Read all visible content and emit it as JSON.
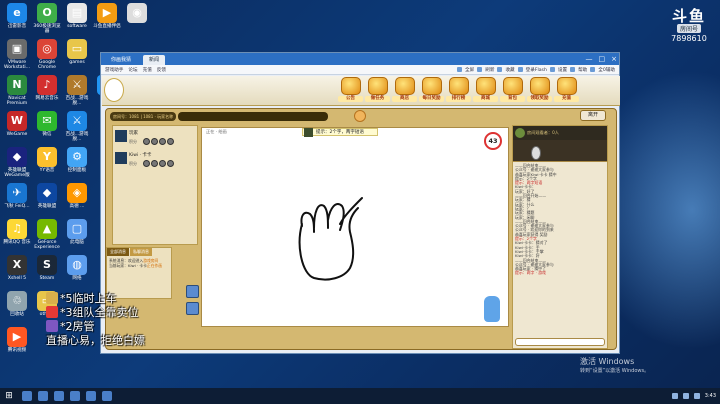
{
  "desktop": {
    "icons": [
      {
        "label": "迅雷影音",
        "color": "#1d87e8",
        "glyph": "e"
      },
      {
        "label": "360极速浏览器",
        "color": "#3fae49",
        "glyph": "O"
      },
      {
        "label": "software",
        "color": "#e8e8e8",
        "glyph": "▤"
      },
      {
        "label": "斗鱼直播伴侣",
        "color": "#f39c12",
        "glyph": "▶"
      },
      {
        "label": "",
        "color": "#dddddd",
        "glyph": "◉"
      },
      {
        "label": "VMware Workstati...",
        "color": "#6b6b6b",
        "glyph": "▣"
      },
      {
        "label": "Google Chrome",
        "color": "#db4437",
        "glyph": "◎"
      },
      {
        "label": "games",
        "color": "#e8c64a",
        "glyph": "▭"
      },
      {
        "label": "Navicat Premium",
        "color": "#2b8a3e",
        "glyph": "N"
      },
      {
        "label": "网易云音乐",
        "color": "#d32f2f",
        "glyph": "♪"
      },
      {
        "label": "百战...游戏脱...",
        "color": "#b07a2c",
        "glyph": "⚔"
      },
      {
        "label": "QQ",
        "color": "#2196f3",
        "glyph": "Q"
      },
      {
        "label": "WeGame",
        "color": "#c62828",
        "glyph": "W"
      },
      {
        "label": "微信",
        "color": "#2eb82e",
        "glyph": "✉"
      },
      {
        "label": "百战...游戏脱...",
        "color": "#1e88e5",
        "glyph": "⚔"
      },
      {
        "label": "英雄联盟 WeGame版",
        "color": "#1a237e",
        "glyph": "◆"
      },
      {
        "label": "YY语音",
        "color": "#fbc02d",
        "glyph": "Y"
      },
      {
        "label": "控制面板",
        "color": "#42a5f5",
        "glyph": "⚙"
      },
      {
        "label": "飞秋 FeiQ...",
        "color": "#1976d2",
        "glyph": "✈"
      },
      {
        "label": "英雄联盟",
        "color": "#0d47a1",
        "glyph": "◆"
      },
      {
        "label": "高德 ...",
        "color": "#ff9800",
        "glyph": "◈"
      },
      {
        "label": "腾讯QQ 音乐",
        "color": "#fdd835",
        "glyph": "♫"
      },
      {
        "label": "GeForce Experience",
        "color": "#76b900",
        "glyph": "▲"
      },
      {
        "label": "此电脑",
        "color": "#5c9ded",
        "glyph": "▢"
      },
      {
        "label": "Xshell 5",
        "color": "#333333",
        "glyph": "X"
      },
      {
        "label": "Steam",
        "color": "#1b2838",
        "glyph": "S"
      },
      {
        "label": "网络",
        "color": "#5c9ded",
        "glyph": "◍"
      },
      {
        "label": "回收站",
        "color": "#90a4ae",
        "glyph": "♲"
      },
      {
        "label": "others",
        "color": "#e8c64a",
        "glyph": "▭"
      },
      {
        "label": "腾讯视频",
        "color": "#ff5722",
        "glyph": "▶"
      }
    ]
  },
  "watermark": {
    "brand": "斗鱼",
    "sub": "房间号",
    "room": "7898610"
  },
  "browser": {
    "tabs": [
      "你画我猜",
      "新闻"
    ],
    "nav_links": [
      "游戏助手",
      "论坛",
      "充值",
      "反馈"
    ],
    "toolbar": [
      "全屏",
      "刷新",
      "收藏",
      "登录Flash",
      "设置",
      "帮助",
      "全0辅助"
    ]
  },
  "game": {
    "menu": [
      {
        "label": "公告"
      },
      {
        "label": "做任务"
      },
      {
        "label": "商店"
      },
      {
        "label": "每日奖励"
      },
      {
        "label": "排行榜"
      },
      {
        "label": "商城"
      },
      {
        "label": "背包"
      },
      {
        "label": "领取奖励"
      },
      {
        "label": "充值"
      }
    ],
    "info_bar": "房间号：1081 | 1081 · 玩家名称",
    "leave_button": "离开",
    "players": [
      {
        "name": "玩家",
        "status": "积分"
      },
      {
        "name": "Kiwi · 卡卡",
        "status": "积分"
      }
    ],
    "hint": "提示：2个字，两字短语",
    "timer": "43",
    "canvas_title": "正在 · 绘画",
    "chat_tabs": [
      "全部消息",
      "私聊消息"
    ],
    "chat_lines": [
      {
        "text": "系统消息：欢迎进入",
        "hl": "游戏房间"
      },
      {
        "text": "当前玩家：Kiwi · 卡卡",
        "hl": "正在作画"
      }
    ],
    "right_header": "房间观看者：0人",
    "log": [
      {
        "text": "——回合结束——",
        "red": false
      },
      {
        "text": "公众号 · 谢谢大家参与",
        "red": false
      },
      {
        "text": "恭喜玩家Kiwi·卡卡 猜中",
        "red": false
      },
      {
        "text": "提示：2个字",
        "red": false
      },
      {
        "text": "提示：两字短语",
        "red": true
      },
      {
        "text": "Kiwi·卡卡：",
        "red": false
      },
      {
        "text": "玩家：好了",
        "red": false
      },
      {
        "text": "——回合开始——",
        "red": false
      },
      {
        "text": "玩家：猜",
        "red": false
      },
      {
        "text": "玩家：什么",
        "red": false
      },
      {
        "text": "玩家：？",
        "red": false
      },
      {
        "text": "玩家：猜题",
        "red": false
      },
      {
        "text": "玩家：闲聊",
        "red": false
      },
      {
        "text": "——回合结束——",
        "red": false
      },
      {
        "text": "公众号 · 谢谢大家参与",
        "red": false
      },
      {
        "text": "公众号 · 欢迎你的到来",
        "red": false
      },
      {
        "text": "恭喜玩家获得 奖励",
        "red": false
      },
      {
        "text": "提示：2个字",
        "red": true
      },
      {
        "text": "Kiwi·卡卡：猜对了",
        "red": false
      },
      {
        "text": "Kiwi·卡卡：手",
        "red": false
      },
      {
        "text": "Kiwi·卡卡：手掌",
        "red": false
      },
      {
        "text": "Kiwi·卡卡：好",
        "red": false
      },
      {
        "text": "——回合结束——",
        "red": false
      },
      {
        "text": "公众号 · 谢谢大家参与",
        "red": false
      },
      {
        "text": "恭喜玩家 · 猜中了",
        "red": false
      },
      {
        "text": "提示：两字 · 游戏",
        "red": true
      }
    ]
  },
  "overlay": [
    "*5临时上车",
    "*3组队全靠卖位",
    "*2房管",
    "直播心易，拒绝白嫖"
  ],
  "activate": {
    "title": "激活 Windows",
    "sub": "转到“设置”以激活 Windows。"
  },
  "taskbar": {
    "time": "3:43"
  }
}
